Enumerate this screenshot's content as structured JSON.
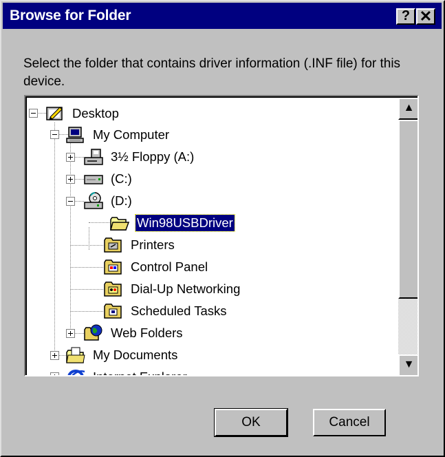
{
  "window": {
    "title": "Browse for Folder",
    "help_glyph": "?",
    "close_glyph": "✕"
  },
  "prompt": "Select the folder that contains driver information (.INF file) for this device.",
  "tree": {
    "items": [
      {
        "label": "Desktop",
        "icon": "desktop-icon",
        "selected": false
      },
      {
        "label": "My Computer",
        "icon": "computer-icon",
        "selected": false
      },
      {
        "label": "3½ Floppy (A:)",
        "icon": "floppy-drive-icon",
        "selected": false
      },
      {
        "label": "(C:)",
        "icon": "hard-drive-icon",
        "selected": false
      },
      {
        "label": "(D:)",
        "icon": "cd-drive-icon",
        "selected": false
      },
      {
        "label": "Win98USBDriver",
        "icon": "folder-open-icon",
        "selected": true
      },
      {
        "label": "Printers",
        "icon": "printers-folder-icon",
        "selected": false
      },
      {
        "label": "Control Panel",
        "icon": "control-panel-icon",
        "selected": false
      },
      {
        "label": "Dial-Up Networking",
        "icon": "dial-up-networking-icon",
        "selected": false
      },
      {
        "label": "Scheduled Tasks",
        "icon": "scheduled-tasks-icon",
        "selected": false
      },
      {
        "label": "Web Folders",
        "icon": "web-folders-icon",
        "selected": false
      },
      {
        "label": "My Documents",
        "icon": "my-documents-icon",
        "selected": false
      },
      {
        "label": "Internet Explorer",
        "icon": "internet-explorer-icon",
        "selected": false
      }
    ]
  },
  "scrollbar": {
    "up_glyph": "▲",
    "down_glyph": "▼"
  },
  "buttons": {
    "ok_label": "OK",
    "cancel_label": "Cancel"
  },
  "colors": {
    "titlebar": "#000080",
    "face": "#c0c0c0",
    "selection": "#000080"
  }
}
